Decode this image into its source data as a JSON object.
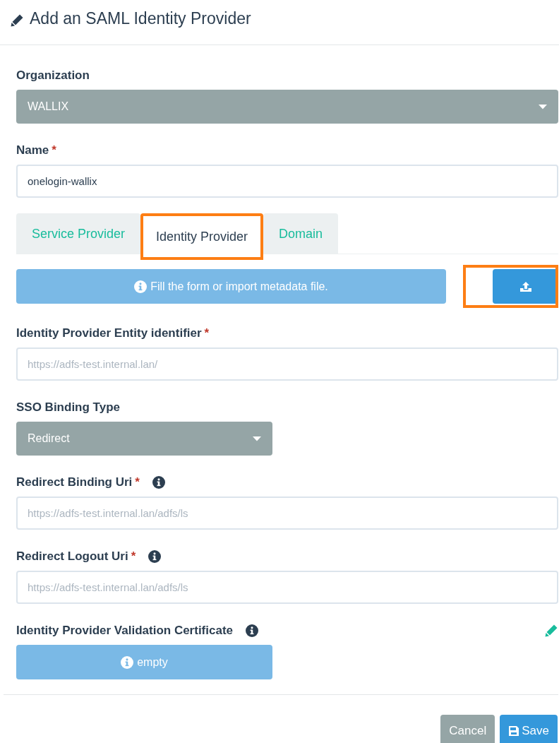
{
  "title": "Add an SAML Identity Provider",
  "organization": {
    "label": "Organization",
    "value": "WALLIX"
  },
  "name": {
    "label": "Name",
    "required_mark": "*",
    "value": "onelogin-wallix"
  },
  "tabs": [
    {
      "label": "Service Provider",
      "selected": false,
      "highlighted": false
    },
    {
      "label": "Identity Provider",
      "selected": true,
      "highlighted": true
    },
    {
      "label": "Domain",
      "selected": false,
      "highlighted": false
    }
  ],
  "metadata": {
    "message": "Fill the form or import metadata file.",
    "upload_highlighted": true
  },
  "fields": [
    {
      "kind": "text",
      "label": "Identity Provider Entity identifier",
      "required_mark": "*",
      "info": false,
      "placeholder": "https://adfs-test.internal.lan/"
    },
    {
      "kind": "select",
      "label": "SSO Binding Type",
      "info": false,
      "value": "Redirect"
    },
    {
      "kind": "text",
      "label": "Redirect Binding Uri",
      "required_mark": "*",
      "info": true,
      "placeholder": "https://adfs-test.internal.lan/adfs/ls"
    },
    {
      "kind": "text",
      "label": "Redirect Logout Uri",
      "required_mark": "*",
      "info": true,
      "placeholder": "https://adfs-test.internal.lan/adfs/ls"
    },
    {
      "kind": "certificate",
      "label": "Identity Provider Validation Certificate",
      "info": true,
      "value": "empty"
    }
  ],
  "buttons": [
    {
      "label": "Cancel",
      "kind": "secondary"
    },
    {
      "label": "Save",
      "kind": "primary"
    }
  ]
}
